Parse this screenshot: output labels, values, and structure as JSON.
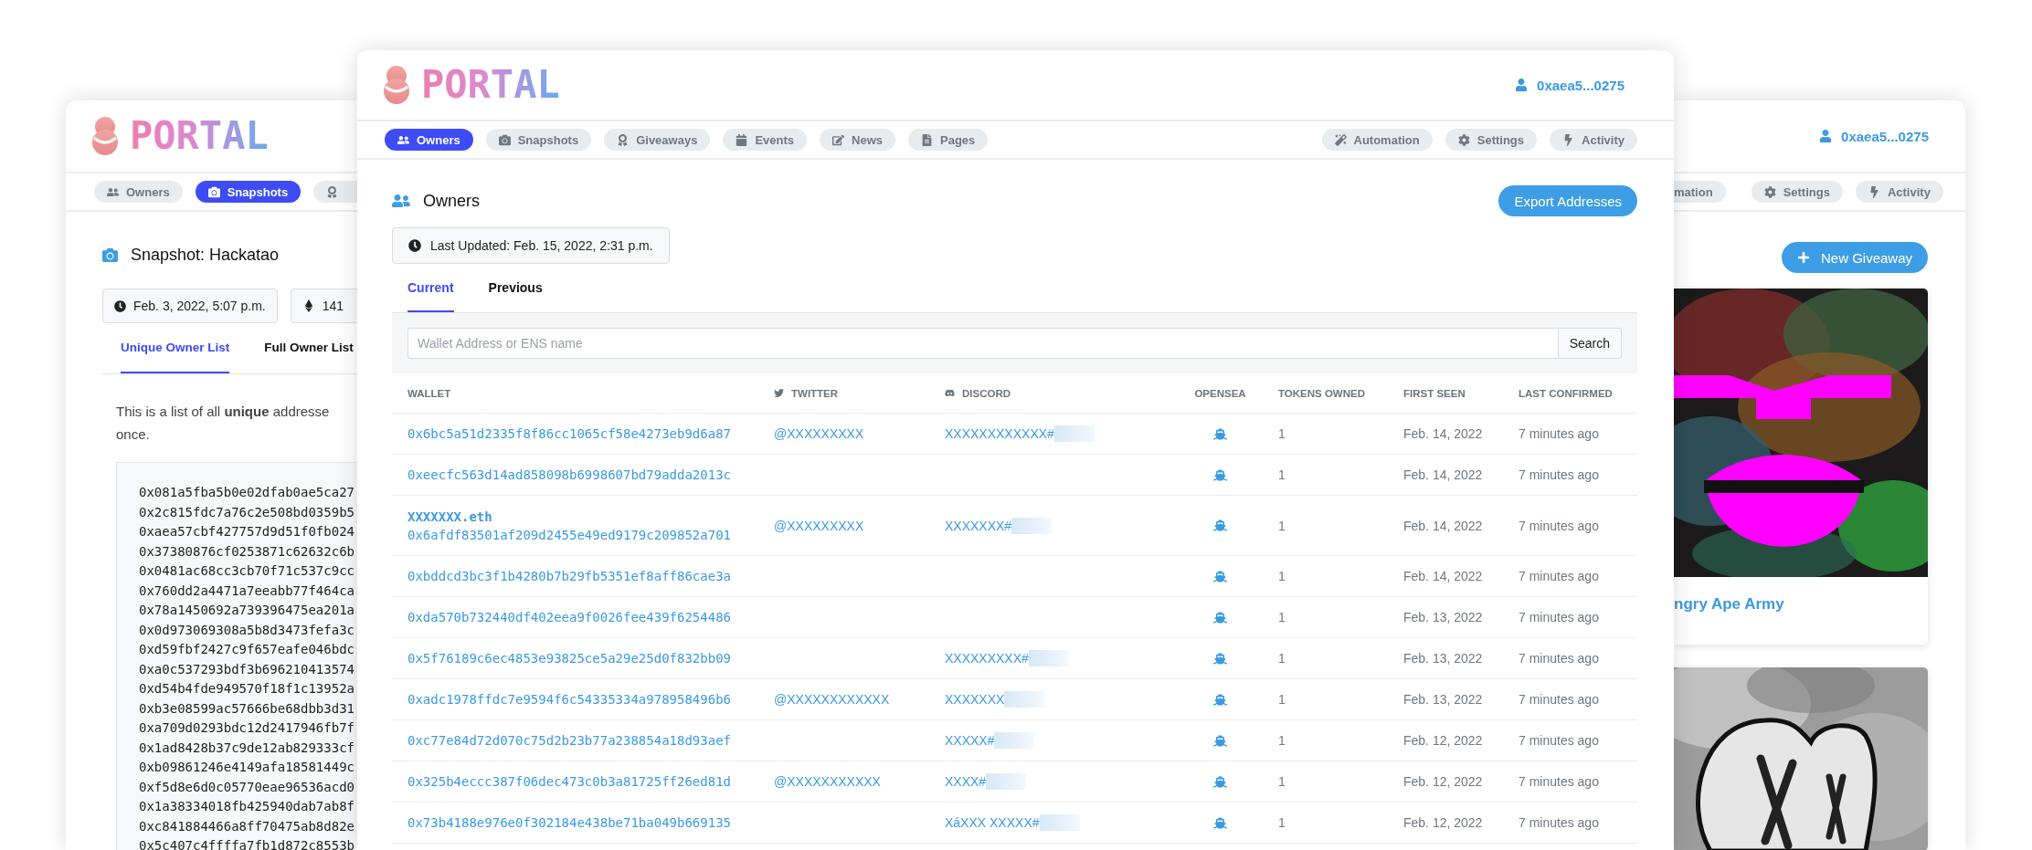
{
  "snapshot_window": {
    "brand": "PORTAL",
    "nav_tabs": [
      {
        "label": "Owners",
        "selected": false
      },
      {
        "label": "Snapshots",
        "selected": true
      },
      {
        "selected": false
      }
    ],
    "title": "Snapshot: Hackatao",
    "date": "Feb. 3, 2022, 5:07 p.m.",
    "token_count": "141",
    "tabs": [
      {
        "label": "Unique Owner List",
        "selected": true
      },
      {
        "label": "Full Owner List",
        "selected": false
      }
    ],
    "intro": "This is a list of all **unique** addresse",
    "intro_end": "once.",
    "addresses": [
      "0x081a5fba5b0e02dfab0ae5ca27",
      "0x2c815fdc7a76c2e508bd0359b5",
      "0xaea57cbf427757d9d51f0fb024",
      "0x37380876cf0253871c62632c6b",
      "0x0481ac68cc3cb70f71c537c9cc",
      "0x760dd2a4471a7eeabb77f464ca",
      "0x78a1450692a739396475ea201a",
      "0x0d973069308a5b8d3473fefa3c",
      "0xd59fbf2427c9f657eafe046bdc",
      "0xa0c537293bdf3b696210413574",
      "0xd54b4fde949570f18f1c13952a",
      "0xb3e08599ac57666be68dbb3d31",
      "0xa709d0293bdc12d2417946fb7f",
      "0x1ad8428b37c9de12ab829333cf",
      "0xb09861246e4149afa18581449c",
      "0xf5d8e6d0c05770eae96536acd0",
      "0x1a38334018fb425940dab7ab8f",
      "0xc841884466a8ff70475ab8d82e",
      "0x5c407c4ffffa7fb1d872c8553b"
    ]
  },
  "main_window": {
    "brand": "PORTAL",
    "user": "0xaea5...0275",
    "nav_left": [
      {
        "label": "Owners",
        "selected": true
      },
      {
        "label": "Snapshots",
        "selected": false
      },
      {
        "label": "Giveaways",
        "selected": false
      },
      {
        "label": "Events",
        "selected": false
      },
      {
        "label": "News",
        "selected": false
      },
      {
        "label": "Pages",
        "selected": false
      }
    ],
    "nav_right": [
      {
        "label": "Automation",
        "selected": false
      },
      {
        "label": "Settings",
        "selected": false
      },
      {
        "label": "Activity",
        "selected": false
      }
    ],
    "title": "Owners",
    "export_button": "Export Addresses",
    "last_updated": "Last Updated: Feb. 15, 2022, 2:31 p.m.",
    "tabs": [
      {
        "label": "Current",
        "selected": true
      },
      {
        "label": "Previous",
        "selected": false
      }
    ],
    "search": {
      "placeholder": "Wallet Address or ENS name",
      "button": "Search"
    },
    "table": {
      "columns": [
        "WALLET",
        "TWITTER",
        "DISCORD",
        "OPENSEA",
        "TOKENS OWNED",
        "FIRST SEEN",
        "LAST CONFIRMED"
      ],
      "rows": [
        {
          "wallet": "0x6bc5a51d2335f8f86cc1065cf58e4273eb9d6a87",
          "twitter": "@XXXXXXXXX",
          "discord": "XXXXXXXXXXXX#",
          "tokens": "1",
          "first_seen": "Feb. 14, 2022",
          "last_confirmed": "7 minutes ago"
        },
        {
          "wallet": "0xeecfc563d14ad858098b6998607bd79adda2013c",
          "tokens": "1",
          "first_seen": "Feb. 14, 2022",
          "last_confirmed": "7 minutes ago"
        },
        {
          "ens": "XXXXXXX.eth",
          "wallet": "0x6afdf83501af209d2455e49ed9179c209852a701",
          "twitter": "@XXXXXXXXX",
          "discord": "XXXXXXX#",
          "tokens": "1",
          "first_seen": "Feb. 14, 2022",
          "last_confirmed": "7 minutes ago"
        },
        {
          "wallet": "0xbddcd3bc3f1b4280b7b29fb5351ef8aff86cae3a",
          "tokens": "1",
          "first_seen": "Feb. 14, 2022",
          "last_confirmed": "7 minutes ago"
        },
        {
          "wallet": "0xda570b732440df402eea9f0026fee439f6254486",
          "tokens": "1",
          "first_seen": "Feb. 13, 2022",
          "last_confirmed": "7 minutes ago"
        },
        {
          "wallet": "0x5f76189c6ec4853e93825ce5a29e25d0f832bb09",
          "discord": "XXXXXXXXX#",
          "tokens": "1",
          "first_seen": "Feb. 13, 2022",
          "last_confirmed": "7 minutes ago"
        },
        {
          "wallet": "0xadc1978ffdc7e9594f6c54335334a978958496b6",
          "twitter": "@XXXXXXXXXXXX",
          "discord": "XXXXXXX",
          "tokens": "1",
          "first_seen": "Feb. 13, 2022",
          "last_confirmed": "7 minutes ago"
        },
        {
          "wallet": "0xc77e84d72d070c75d2b23b77a238854a18d93aef",
          "discord": "XXXXX#",
          "tokens": "1",
          "first_seen": "Feb. 12, 2022",
          "last_confirmed": "7 minutes ago"
        },
        {
          "wallet": "0x325b4eccc387f06dec473c0b3a81725ff26ed81d",
          "twitter": "@XXXXXXXXXXX",
          "discord": "XXXX#",
          "tokens": "1",
          "first_seen": "Feb. 12, 2022",
          "last_confirmed": "7 minutes ago"
        },
        {
          "wallet": "0x73b4188e976e0f302184e438be71ba049b669135",
          "discord": "XáXXX XXXXX#",
          "tokens": "1",
          "first_seen": "Feb. 12, 2022",
          "last_confirmed": "7 minutes ago"
        }
      ]
    }
  },
  "giveaway_window": {
    "user": "0xaea5...0275",
    "nav_tabs": [
      {
        "label": "mation",
        "selected": false
      },
      {
        "label": "Settings",
        "selected": false
      },
      {
        "label": "Activity",
        "selected": false
      }
    ],
    "new_button": "New Giveaway",
    "cards": [
      {
        "kind": "picture",
        "title": "ngry Ape Army"
      },
      {
        "kind": "picture"
      }
    ]
  }
}
